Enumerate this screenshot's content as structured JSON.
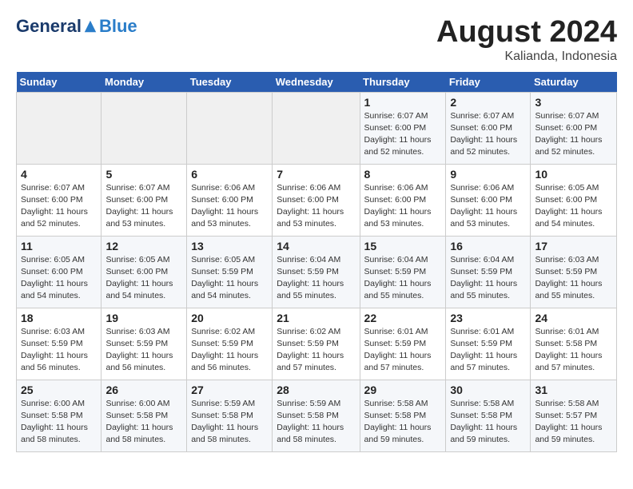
{
  "header": {
    "logo_general": "General",
    "logo_blue": "Blue",
    "month_year": "August 2024",
    "location": "Kalianda, Indonesia"
  },
  "days_of_week": [
    "Sunday",
    "Monday",
    "Tuesday",
    "Wednesday",
    "Thursday",
    "Friday",
    "Saturday"
  ],
  "weeks": [
    [
      {
        "day": "",
        "info": ""
      },
      {
        "day": "",
        "info": ""
      },
      {
        "day": "",
        "info": ""
      },
      {
        "day": "",
        "info": ""
      },
      {
        "day": "1",
        "info": "Sunrise: 6:07 AM\nSunset: 6:00 PM\nDaylight: 11 hours\nand 52 minutes."
      },
      {
        "day": "2",
        "info": "Sunrise: 6:07 AM\nSunset: 6:00 PM\nDaylight: 11 hours\nand 52 minutes."
      },
      {
        "day": "3",
        "info": "Sunrise: 6:07 AM\nSunset: 6:00 PM\nDaylight: 11 hours\nand 52 minutes."
      }
    ],
    [
      {
        "day": "4",
        "info": "Sunrise: 6:07 AM\nSunset: 6:00 PM\nDaylight: 11 hours\nand 52 minutes."
      },
      {
        "day": "5",
        "info": "Sunrise: 6:07 AM\nSunset: 6:00 PM\nDaylight: 11 hours\nand 53 minutes."
      },
      {
        "day": "6",
        "info": "Sunrise: 6:06 AM\nSunset: 6:00 PM\nDaylight: 11 hours\nand 53 minutes."
      },
      {
        "day": "7",
        "info": "Sunrise: 6:06 AM\nSunset: 6:00 PM\nDaylight: 11 hours\nand 53 minutes."
      },
      {
        "day": "8",
        "info": "Sunrise: 6:06 AM\nSunset: 6:00 PM\nDaylight: 11 hours\nand 53 minutes."
      },
      {
        "day": "9",
        "info": "Sunrise: 6:06 AM\nSunset: 6:00 PM\nDaylight: 11 hours\nand 53 minutes."
      },
      {
        "day": "10",
        "info": "Sunrise: 6:05 AM\nSunset: 6:00 PM\nDaylight: 11 hours\nand 54 minutes."
      }
    ],
    [
      {
        "day": "11",
        "info": "Sunrise: 6:05 AM\nSunset: 6:00 PM\nDaylight: 11 hours\nand 54 minutes."
      },
      {
        "day": "12",
        "info": "Sunrise: 6:05 AM\nSunset: 6:00 PM\nDaylight: 11 hours\nand 54 minutes."
      },
      {
        "day": "13",
        "info": "Sunrise: 6:05 AM\nSunset: 5:59 PM\nDaylight: 11 hours\nand 54 minutes."
      },
      {
        "day": "14",
        "info": "Sunrise: 6:04 AM\nSunset: 5:59 PM\nDaylight: 11 hours\nand 55 minutes."
      },
      {
        "day": "15",
        "info": "Sunrise: 6:04 AM\nSunset: 5:59 PM\nDaylight: 11 hours\nand 55 minutes."
      },
      {
        "day": "16",
        "info": "Sunrise: 6:04 AM\nSunset: 5:59 PM\nDaylight: 11 hours\nand 55 minutes."
      },
      {
        "day": "17",
        "info": "Sunrise: 6:03 AM\nSunset: 5:59 PM\nDaylight: 11 hours\nand 55 minutes."
      }
    ],
    [
      {
        "day": "18",
        "info": "Sunrise: 6:03 AM\nSunset: 5:59 PM\nDaylight: 11 hours\nand 56 minutes."
      },
      {
        "day": "19",
        "info": "Sunrise: 6:03 AM\nSunset: 5:59 PM\nDaylight: 11 hours\nand 56 minutes."
      },
      {
        "day": "20",
        "info": "Sunrise: 6:02 AM\nSunset: 5:59 PM\nDaylight: 11 hours\nand 56 minutes."
      },
      {
        "day": "21",
        "info": "Sunrise: 6:02 AM\nSunset: 5:59 PM\nDaylight: 11 hours\nand 57 minutes."
      },
      {
        "day": "22",
        "info": "Sunrise: 6:01 AM\nSunset: 5:59 PM\nDaylight: 11 hours\nand 57 minutes."
      },
      {
        "day": "23",
        "info": "Sunrise: 6:01 AM\nSunset: 5:59 PM\nDaylight: 11 hours\nand 57 minutes."
      },
      {
        "day": "24",
        "info": "Sunrise: 6:01 AM\nSunset: 5:58 PM\nDaylight: 11 hours\nand 57 minutes."
      }
    ],
    [
      {
        "day": "25",
        "info": "Sunrise: 6:00 AM\nSunset: 5:58 PM\nDaylight: 11 hours\nand 58 minutes."
      },
      {
        "day": "26",
        "info": "Sunrise: 6:00 AM\nSunset: 5:58 PM\nDaylight: 11 hours\nand 58 minutes."
      },
      {
        "day": "27",
        "info": "Sunrise: 5:59 AM\nSunset: 5:58 PM\nDaylight: 11 hours\nand 58 minutes."
      },
      {
        "day": "28",
        "info": "Sunrise: 5:59 AM\nSunset: 5:58 PM\nDaylight: 11 hours\nand 58 minutes."
      },
      {
        "day": "29",
        "info": "Sunrise: 5:58 AM\nSunset: 5:58 PM\nDaylight: 11 hours\nand 59 minutes."
      },
      {
        "day": "30",
        "info": "Sunrise: 5:58 AM\nSunset: 5:58 PM\nDaylight: 11 hours\nand 59 minutes."
      },
      {
        "day": "31",
        "info": "Sunrise: 5:58 AM\nSunset: 5:57 PM\nDaylight: 11 hours\nand 59 minutes."
      }
    ]
  ]
}
